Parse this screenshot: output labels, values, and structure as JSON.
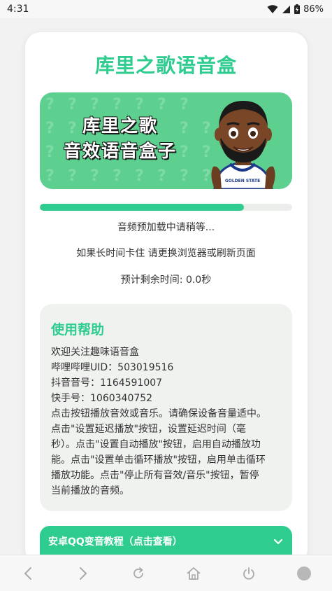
{
  "status_bar": {
    "time": "4:31",
    "battery": "86%"
  },
  "app": {
    "title": "库里之歌语音盒"
  },
  "banner": {
    "line1": "库里之歌",
    "line2": "音效语音盒子",
    "jersey_text": "GOLDEN STATE"
  },
  "progress": {
    "fraction": 0.81
  },
  "loading": {
    "status": "音频预加载中请稍等...",
    "hint": "如果长时间卡住 请更换浏览器或刷新页面",
    "eta": "预计剩余时间: 0.0秒"
  },
  "help": {
    "title": "使用帮助",
    "lines": [
      "欢迎关注趣味语音盒",
      "哔哩哔哩UID：503019516",
      "抖音音号：1164591007",
      "快手号：1060340752",
      "点击按钮播放音效或音乐。请确保设备音量适中。",
      "点击\"设置延迟播放\"按钮，设置延迟时间（毫",
      "秒）。点击\"设置自动播放\"按钮，启用自动播放功",
      "能。点击\"设置单击循环播放\"按钮，启用单击循环",
      "播放功能。点击\"停止所有音效/音乐\"按钮，暂停",
      "当前播放的音频。"
    ]
  },
  "tutorial": {
    "label": "安卓QQ变音教程（点击查看）"
  },
  "colors": {
    "accent": "#2ecc8f",
    "banner_bg": "#5dcf8e"
  },
  "icons": {
    "back": "chevron-left-icon",
    "forward": "chevron-right-icon",
    "refresh": "refresh-icon",
    "home": "home-icon",
    "power": "power-icon",
    "tabs": "circle-icon"
  }
}
